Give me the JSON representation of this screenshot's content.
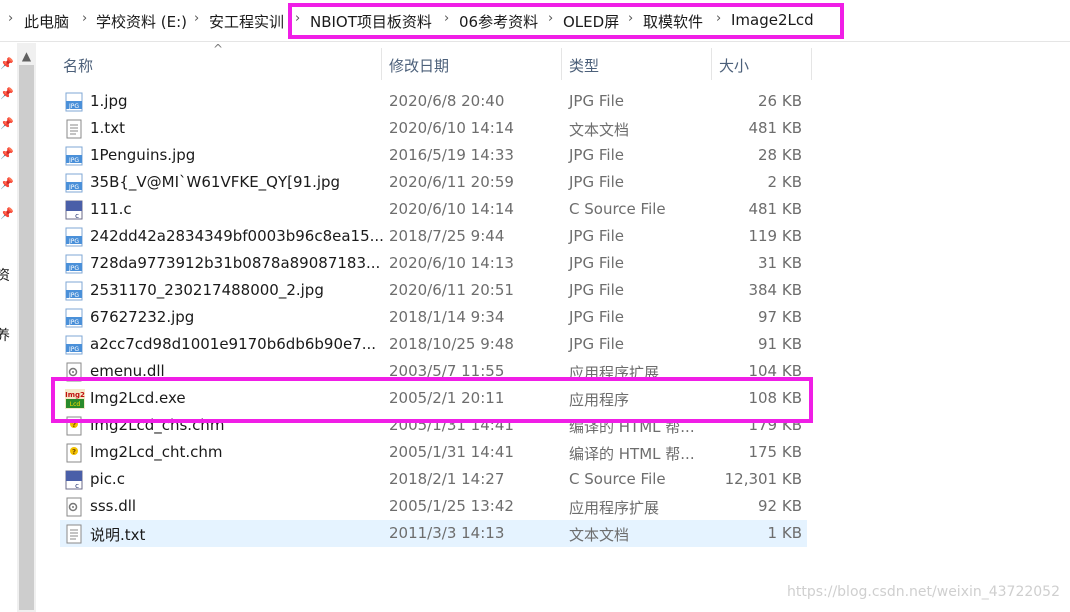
{
  "breadcrumb": [
    "此电脑",
    "学校资料 (E:)",
    "安工程实训",
    "NBIOT项目板资料",
    "06参考资料",
    "OLED屏",
    "取模软件",
    "Image2Lcd"
  ],
  "nav": {
    "frag_1": "资",
    "frag_2": "养"
  },
  "columns": {
    "name": "名称",
    "date": "修改日期",
    "type": "类型",
    "size": "大小"
  },
  "files": [
    {
      "name": "1.jpg",
      "date": "2020/6/8 20:40",
      "type": "JPG File",
      "size": "26 KB",
      "icon": "jpg-file-icon"
    },
    {
      "name": "1.txt",
      "date": "2020/6/10 14:14",
      "type": "文本文档",
      "size": "481 KB",
      "icon": "text-file-icon"
    },
    {
      "name": "1Penguins.jpg",
      "date": "2016/5/19 14:33",
      "type": "JPG File",
      "size": "28 KB",
      "icon": "jpg-file-icon"
    },
    {
      "name": "35B{_V@MI`W61VFKE_QY[91.jpg",
      "date": "2020/6/11 20:59",
      "type": "JPG File",
      "size": "2 KB",
      "icon": "jpg-file-icon"
    },
    {
      "name": "111.c",
      "date": "2020/6/10 14:14",
      "type": "C Source File",
      "size": "481 KB",
      "icon": "c-source-file-icon"
    },
    {
      "name": "242dd42a2834349bf0003b96c8ea15...",
      "date": "2018/7/25 9:44",
      "type": "JPG File",
      "size": "119 KB",
      "icon": "jpg-file-icon"
    },
    {
      "name": "728da9773912b31b0878a89087183...",
      "date": "2020/6/10 14:13",
      "type": "JPG File",
      "size": "31 KB",
      "icon": "jpg-file-icon"
    },
    {
      "name": "2531170_230217488000_2.jpg",
      "date": "2020/6/11 20:51",
      "type": "JPG File",
      "size": "384 KB",
      "icon": "jpg-file-icon"
    },
    {
      "name": "67627232.jpg",
      "date": "2018/1/14 9:34",
      "type": "JPG File",
      "size": "97 KB",
      "icon": "jpg-file-icon"
    },
    {
      "name": "a2cc7cd98d1001e9170b6db6b90e7...",
      "date": "2018/10/25 9:48",
      "type": "JPG File",
      "size": "91 KB",
      "icon": "jpg-file-icon"
    },
    {
      "name": "emenu.dll",
      "date": "2003/5/7 11:55",
      "type": "应用程序扩展",
      "size": "104 KB",
      "icon": "dll-file-icon"
    },
    {
      "name": "Img2Lcd.exe",
      "date": "2005/2/1 20:11",
      "type": "应用程序",
      "size": "108 KB",
      "icon": "img2lcd-app-icon"
    },
    {
      "name": "Img2Lcd_chs.chm",
      "date": "2005/1/31 14:41",
      "type": "编译的 HTML 帮...",
      "size": "179 KB",
      "icon": "chm-help-file-icon"
    },
    {
      "name": "Img2Lcd_cht.chm",
      "date": "2005/1/31 14:41",
      "type": "编译的 HTML 帮...",
      "size": "175 KB",
      "icon": "chm-help-file-icon"
    },
    {
      "name": "pic.c",
      "date": "2018/2/1 14:27",
      "type": "C Source File",
      "size": "12,301 KB",
      "icon": "c-source-file-icon"
    },
    {
      "name": "sss.dll",
      "date": "2005/1/25 13:42",
      "type": "应用程序扩展",
      "size": "92 KB",
      "icon": "dll-file-icon"
    },
    {
      "name": "说明.txt",
      "date": "2011/3/3 14:13",
      "type": "文本文档",
      "size": "1 KB",
      "icon": "text-file-icon"
    }
  ],
  "selected_file": "说明.txt",
  "colors": {
    "highlight": "#f01ee6",
    "selection": "#e5f3ff",
    "header_text": "#4c607a"
  },
  "watermark": "https://blog.csdn.net/weixin_43722052"
}
